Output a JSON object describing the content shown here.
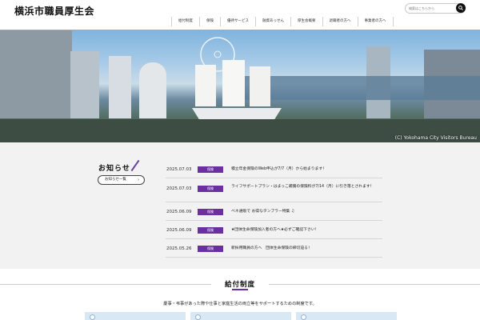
{
  "header": {
    "site_title": "横浜市職員厚生会",
    "search_placeholder": "検索はこちらから",
    "nav": [
      "給付制度",
      "保険",
      "優待サービス",
      "融資あっせん",
      "厚生会概要",
      "退職者の方へ",
      "事業者の方へ"
    ]
  },
  "hero": {
    "credit": "(C) Yokohama City Visitors Bureau"
  },
  "news": {
    "title": "お知らせ",
    "more_label": "お知らせ一覧",
    "more_arrow": "›",
    "items": [
      {
        "date": "2025.07.03",
        "tag": "保険",
        "text": "積立年金保険のWeb申込が7/7（月）から始まります！"
      },
      {
        "date": "2025.07.03",
        "tag": "保険",
        "text": "ライフサポートプラン・はまっこ補償の保険料が7/14（月）に引き落とされます！"
      },
      {
        "date": "2025.06.09",
        "tag": "保険",
        "text": "ベネ通販で お得なタンブラー特集 ♫"
      },
      {
        "date": "2025.06.09",
        "tag": "保険",
        "text": "★団体生命保険加入者の方へ★必ずご確認下さい！"
      },
      {
        "date": "2025.05.26",
        "tag": "保険",
        "text": "新採用職員の方へ　団体生命保険の締切迫る！"
      }
    ]
  },
  "salary": {
    "title": "給付制度",
    "description": "慶事・弔事があった際や仕事と家庭生活の両立等をサポートするための制度です。"
  }
}
